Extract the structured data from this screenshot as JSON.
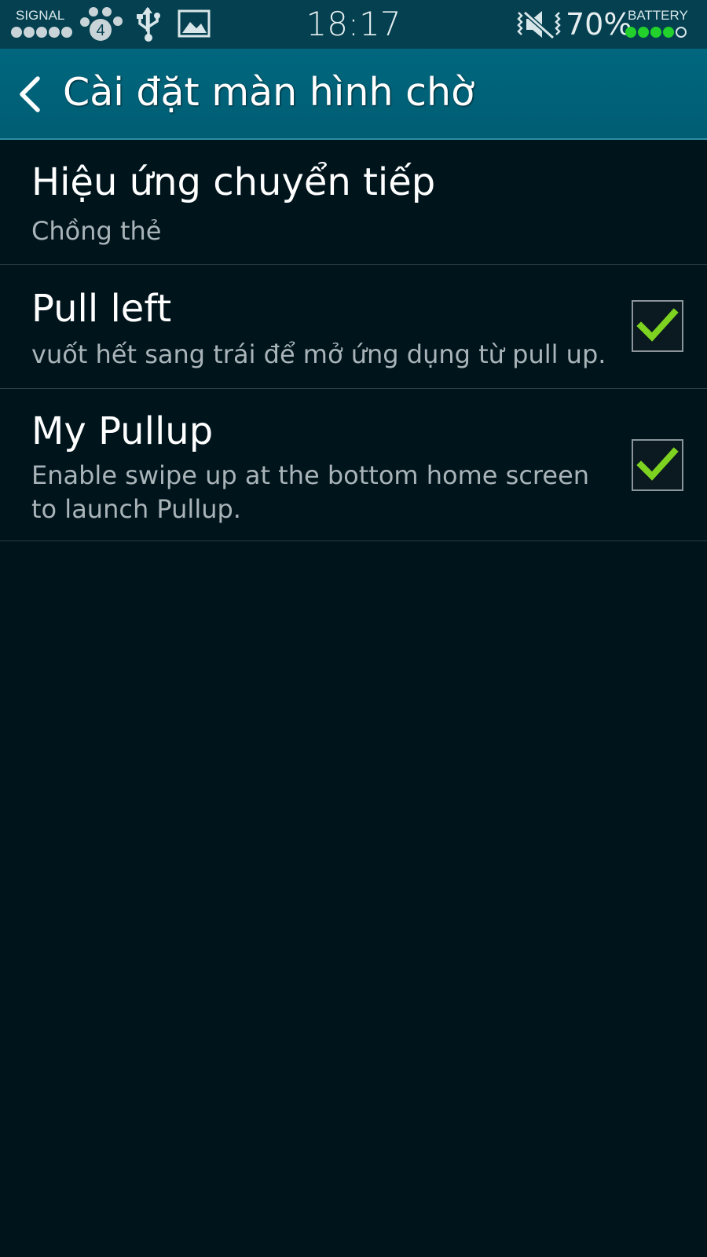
{
  "status_bar": {
    "signal_label": "SIGNAL",
    "network_badge": "4",
    "time": "18:17",
    "battery_percent": "70%",
    "battery_label": "BATTERY",
    "signal_dots": 5,
    "battery_dots_filled": 4,
    "battery_dots_total": 5,
    "accent_green": "#22d12b"
  },
  "header": {
    "title": "Cài đặt màn hình chờ",
    "back_icon": "chevron-left-icon"
  },
  "settings": [
    {
      "title": "Hiệu ứng chuyển tiếp",
      "summary": "Chồng thẻ"
    },
    {
      "title": "Pull left",
      "summary": "vuốt hết sang trái để mở ứng dụng từ pull up.",
      "checked": true
    },
    {
      "title": "My Pullup",
      "summary": "Enable swipe up at the bottom home screen to launch Pullup.",
      "checked": true
    }
  ],
  "colors": {
    "status_bar_bg": "#04404f",
    "action_bar_bg": "#00677e",
    "list_bg": "#00141c",
    "check_green": "#7ed321"
  }
}
